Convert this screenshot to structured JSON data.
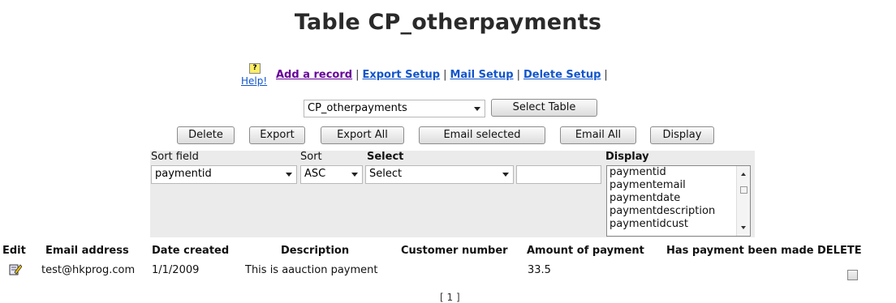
{
  "page_title": "Table CP_otherpayments",
  "nav": {
    "help": "Help!",
    "add_record": "Add a record",
    "export_setup": "Export Setup",
    "mail_setup": "Mail Setup",
    "delete_setup": "Delete Setup",
    "separator": "|"
  },
  "table_select": {
    "value": "CP_otherpayments",
    "button": "Select Table"
  },
  "actions": [
    "Delete",
    "Export",
    "Export All",
    "Email selected",
    "Email All",
    "Display"
  ],
  "filters": {
    "sort_field_label": "Sort field",
    "sort_field_value": "paymentid",
    "sort_label": "Sort",
    "sort_value": "ASC",
    "select_label": "Select",
    "select_value": "Select",
    "search_value": "",
    "display_label": "Display",
    "display_options": [
      "paymentid",
      "paymentemail",
      "paymentdate",
      "paymentdescription",
      "paymentidcust"
    ]
  },
  "columns": [
    "Edit",
    "Email address",
    "Date created",
    "Description",
    "Customer number",
    "Amount of payment",
    "Has payment been made",
    "DELETE"
  ],
  "rows": [
    {
      "email": "test@hkprog.com",
      "date": "1/1/2009",
      "description": "This is aauction payment",
      "customer": "",
      "amount": "33.5",
      "paid": ""
    }
  ],
  "pager": "[ 1 ]",
  "icons": {
    "help": "help-question-icon",
    "edit": "edit-pencil-icon"
  }
}
